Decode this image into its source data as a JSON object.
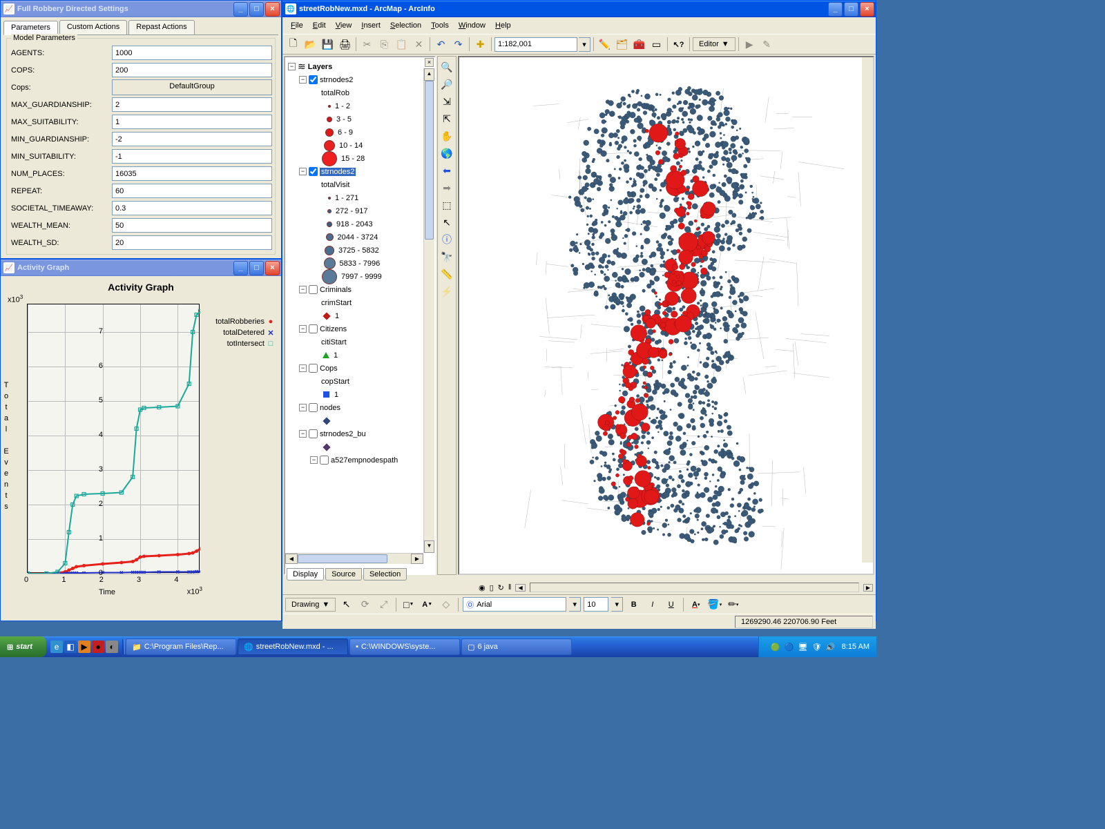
{
  "settings_window": {
    "title": "Full Robbery Directed Settings",
    "tabs": [
      "Parameters",
      "Custom Actions",
      "Repast Actions"
    ],
    "group_label": "Model Parameters",
    "params": [
      {
        "label": "AGENTS:",
        "value": "1000"
      },
      {
        "label": "COPS:",
        "value": "200"
      },
      {
        "label": "Cops:",
        "value": "DefaultGroup",
        "is_button": true
      },
      {
        "label": "MAX_GUARDIANSHIP:",
        "value": "2"
      },
      {
        "label": "MAX_SUITABILITY:",
        "value": "1"
      },
      {
        "label": "MIN_GUARDIANSHIP:",
        "value": "-2"
      },
      {
        "label": "MIN_SUITABILITY:",
        "value": "-1"
      },
      {
        "label": "NUM_PLACES:",
        "value": "16035"
      },
      {
        "label": "REPEAT:",
        "value": "60"
      },
      {
        "label": "SOCIETAL_TIMEAWAY:",
        "value": "0.3"
      },
      {
        "label": "WEALTH_MEAN:",
        "value": "50"
      },
      {
        "label": "WEALTH_SD:",
        "value": "20"
      }
    ]
  },
  "graph_window": {
    "title": "Activity Graph",
    "chart_title": "Activity Graph",
    "y_label": "Total Events",
    "x_label": "Time",
    "y_exp": "x10",
    "y_exp_sup": "3",
    "x_exp": "x10",
    "x_exp_sup": "3",
    "legend": [
      {
        "label": "totalRobberies",
        "mark": "●",
        "color": "#e8201a"
      },
      {
        "label": "totalDetered",
        "mark": "✕",
        "color": "#2030c8"
      },
      {
        "label": "totIntersect",
        "mark": "□",
        "color": "#1aa89a"
      }
    ]
  },
  "chart_data": {
    "type": "line",
    "title": "Activity Graph",
    "xlabel": "Time (x10³)",
    "ylabel": "Total Events (x10³)",
    "xlim": [
      0,
      4.6
    ],
    "ylim": [
      0,
      7.8
    ],
    "x_ticks": [
      0,
      1,
      2,
      3,
      4
    ],
    "y_ticks": [
      0,
      1,
      2,
      3,
      4,
      5,
      6,
      7
    ],
    "x": [
      0.0,
      0.5,
      0.8,
      1.0,
      1.1,
      1.2,
      1.3,
      1.5,
      2.0,
      2.5,
      2.8,
      2.9,
      3.0,
      3.1,
      3.5,
      4.0,
      4.3,
      4.4,
      4.5,
      4.6
    ],
    "series": [
      {
        "name": "totalRobberies",
        "color": "#e8201a",
        "values": [
          0.0,
          0.0,
          0.02,
          0.05,
          0.1,
          0.15,
          0.2,
          0.23,
          0.28,
          0.32,
          0.35,
          0.4,
          0.48,
          0.5,
          0.52,
          0.55,
          0.58,
          0.6,
          0.65,
          0.72
        ]
      },
      {
        "name": "totalDetered",
        "color": "#2030c8",
        "values": [
          0.0,
          0.0,
          0.0,
          0.01,
          0.01,
          0.02,
          0.02,
          0.02,
          0.03,
          0.03,
          0.04,
          0.04,
          0.04,
          0.04,
          0.05,
          0.05,
          0.05,
          0.05,
          0.06,
          0.06
        ]
      },
      {
        "name": "totIntersect",
        "color": "#1aa89a",
        "values": [
          0.0,
          0.0,
          0.05,
          0.3,
          1.2,
          2.0,
          2.25,
          2.3,
          2.32,
          2.35,
          2.8,
          4.2,
          4.75,
          4.8,
          4.82,
          4.85,
          5.5,
          7.0,
          7.5,
          7.6
        ]
      }
    ]
  },
  "arcmap": {
    "title": "streetRobNew.mxd - ArcMap - ArcInfo",
    "menus": [
      "File",
      "Edit",
      "View",
      "Insert",
      "Selection",
      "Tools",
      "Window",
      "Help"
    ],
    "scale": "1:182,001",
    "editor_label": "Editor",
    "toc_header": "Layers",
    "toc_tabs": [
      "Display",
      "Source",
      "Selection"
    ],
    "layers": {
      "strnodes2_rob": {
        "name": "strnodes2",
        "field": "totalRob",
        "checked": true,
        "classes": [
          {
            "label": "1 - 2",
            "size": 4,
            "fill": "#c01818"
          },
          {
            "label": "3 - 5",
            "size": 8,
            "fill": "#d01818"
          },
          {
            "label": "6 - 9",
            "size": 12,
            "fill": "#e01818"
          },
          {
            "label": "10 - 14",
            "size": 16,
            "fill": "#e82020"
          },
          {
            "label": "15 - 28",
            "size": 22,
            "fill": "#f02020"
          }
        ]
      },
      "strnodes2_visit": {
        "name": "strnodes2",
        "field": "totalVisit",
        "checked": true,
        "selected": true,
        "classes": [
          {
            "label": "1 - 271",
            "size": 4,
            "fill": "#335577"
          },
          {
            "label": "272 - 917",
            "size": 6,
            "fill": "#3a6088"
          },
          {
            "label": "918 - 2043",
            "size": 8,
            "fill": "#3a6088"
          },
          {
            "label": "2044 - 3724",
            "size": 11,
            "fill": "#4a6e92"
          },
          {
            "label": "3725 - 5832",
            "size": 14,
            "fill": "#4a6e92"
          },
          {
            "label": "5833 - 7996",
            "size": 17,
            "fill": "#5a7a9a"
          },
          {
            "label": "7997 - 9999",
            "size": 22,
            "fill": "#5a7a9a"
          }
        ]
      },
      "criminals": {
        "name": "Criminals",
        "field": "crimStart",
        "checked": false,
        "sym_label": "1",
        "sym_color": "#c01818",
        "sym_shape": "diamond"
      },
      "citizens": {
        "name": "Citizens",
        "field": "citiStart",
        "checked": false,
        "sym_label": "1",
        "sym_color": "#20a020",
        "sym_shape": "triangle"
      },
      "cops": {
        "name": "Cops",
        "field": "copStart",
        "checked": false,
        "sym_label": "1",
        "sym_color": "#2050e0",
        "sym_shape": "square"
      },
      "nodes": {
        "name": "nodes",
        "checked": false,
        "sym_color": "#304878",
        "sym_shape": "diamond"
      },
      "strnodes2_bu": {
        "name": "strnodes2_bu",
        "checked": false,
        "sym_color": "#503868",
        "sym_shape": "diamond"
      },
      "a527": {
        "name": "a527empnodespath",
        "checked": false
      }
    },
    "status": "1269290.46 220706.90 Feet",
    "drawing_label": "Drawing",
    "font_name": "Arial",
    "font_size": "10"
  },
  "taskbar": {
    "start": "start",
    "tasks": [
      {
        "label": "C:\\Program Files\\Rep...",
        "icon": "📁"
      },
      {
        "label": "streetRobNew.mxd - ...",
        "icon": "🌐",
        "active": true
      },
      {
        "label": "C:\\WINDOWS\\syste...",
        "icon": "▪"
      },
      {
        "label": "6 java",
        "icon": "▢"
      }
    ],
    "clock": "8:15 AM"
  }
}
